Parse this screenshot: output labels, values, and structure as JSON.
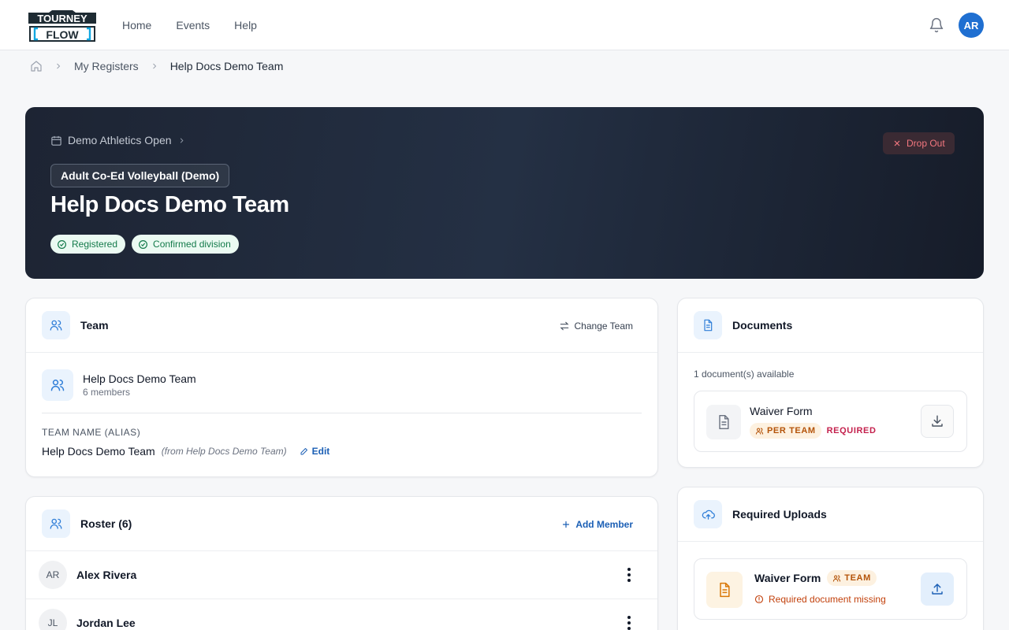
{
  "header": {
    "logo_text_top": "TOURNEY",
    "logo_text_bottom": "FLOW",
    "nav": [
      {
        "label": "Home"
      },
      {
        "label": "Events"
      },
      {
        "label": "Help"
      }
    ],
    "user_initials": "AR"
  },
  "breadcrumb": {
    "items": [
      "My Registers",
      "Help Docs Demo Team"
    ]
  },
  "hero": {
    "event_name": "Demo Athletics Open",
    "division": "Adult Co-Ed Volleyball (Demo)",
    "title": "Help Docs Demo Team",
    "badges": [
      "Registered",
      "Confirmed division"
    ],
    "drop_out_label": "Drop Out"
  },
  "team_card": {
    "title": "Team",
    "change_team_label": "Change Team",
    "team_name": "Help Docs Demo Team",
    "members_text": "6 members",
    "alias_label": "TEAM NAME (ALIAS)",
    "alias_value": "Help Docs Demo Team",
    "alias_from": "(from Help Docs Demo Team)",
    "edit_label": "Edit"
  },
  "roster_card": {
    "title": "Roster (6)",
    "add_member_label": "Add Member",
    "members": [
      {
        "initials": "AR",
        "name": "Alex Rivera"
      },
      {
        "initials": "JL",
        "name": "Jordan Lee"
      }
    ]
  },
  "documents_card": {
    "title": "Documents",
    "count_text": "1 document(s) available",
    "items": [
      {
        "name": "Waiver Form",
        "scope": "PER TEAM",
        "status": "REQUIRED"
      }
    ]
  },
  "uploads_card": {
    "title": "Required Uploads",
    "items": [
      {
        "name": "Waiver Form",
        "scope": "TEAM",
        "status": "Required document missing"
      }
    ]
  },
  "colors": {
    "brand_blue": "#1f6fd1",
    "hero_bg": "#1d2433",
    "success_bg": "#ebfaf2",
    "success_text": "#137a4a",
    "danger": "#f3777f",
    "warning": "#c2410c",
    "required": "#c4214d"
  }
}
